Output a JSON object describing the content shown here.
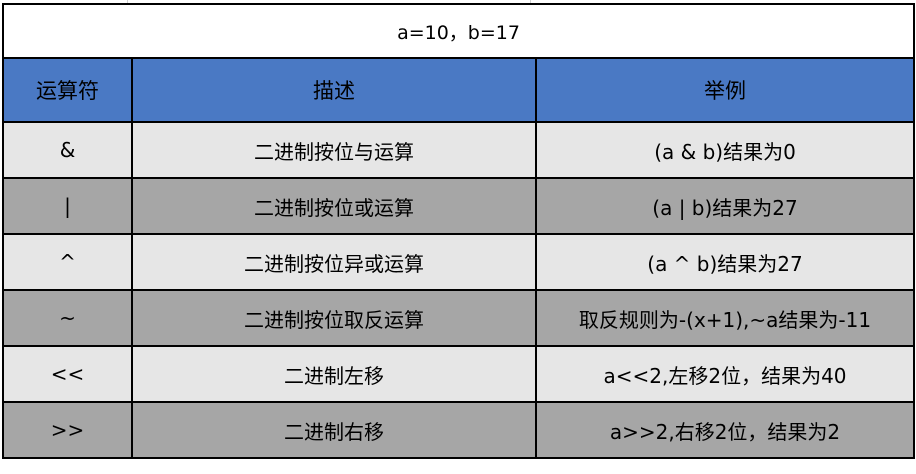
{
  "table": {
    "caption": "a=10，b=17",
    "headers": [
      "运算符",
      "描述",
      "举例"
    ],
    "rows": [
      {
        "op": "&",
        "desc": "二进制按位与运算",
        "example": "(a & b)结果为0"
      },
      {
        "op": "|",
        "desc": "二进制按位或运算",
        "example": "(a | b)结果为27"
      },
      {
        "op": "^",
        "desc": "二进制按位异或运算",
        "example": "(a ^ b)结果为27"
      },
      {
        "op": "~",
        "desc": "二进制按位取反运算",
        "example": "取反规则为-(x+1),~a结果为-11"
      },
      {
        "op": "<<",
        "desc": "二进制左移",
        "example": "a<<2,左移2位，结果为40"
      },
      {
        "op": ">>",
        "desc": "二进制右移",
        "example": "a>>2,右移2位，结果为2"
      }
    ]
  },
  "colors": {
    "header_bg": "#4a79c4",
    "row_light": "#e6e6e6",
    "row_dark": "#a6a6a6",
    "border": "#000000"
  }
}
